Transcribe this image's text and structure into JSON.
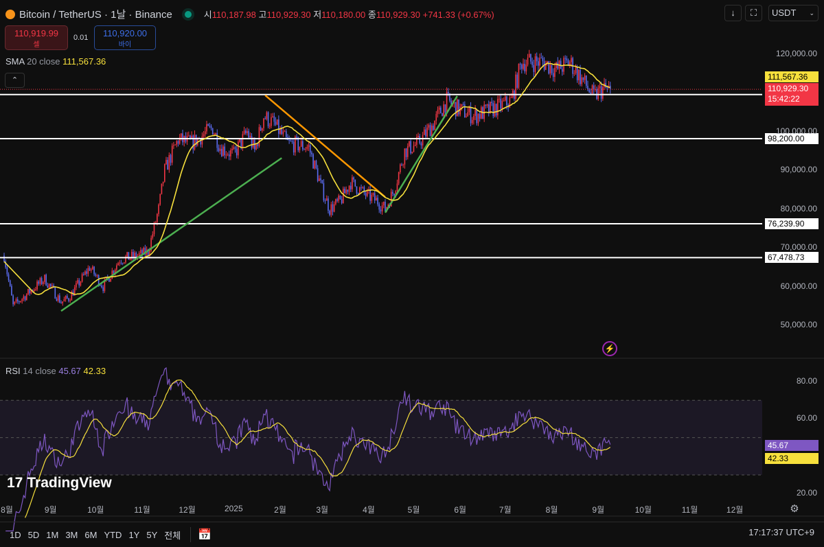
{
  "header": {
    "symbol": "Bitcoin / TetherUS · 1날 · Binance",
    "open_label": "시",
    "open": "110,187.98",
    "high_label": "고",
    "high": "110,929.30",
    "low_label": "저",
    "low": "110,180.00",
    "close_label": "종",
    "close": "110,929.30",
    "change": "+741.33 (+0.67%)"
  },
  "trade": {
    "sell_price": "110,919.99",
    "sell_label": "셀",
    "spread": "0.01",
    "buy_price": "110,920.00",
    "buy_label": "바이"
  },
  "toolbar": {
    "down_icon": "↓",
    "currency": "USDT"
  },
  "sma": {
    "label": "SMA",
    "params": "20 close",
    "value": "111,567.36"
  },
  "rsi": {
    "label": "RSI",
    "params": "14 close",
    "value": "45.67",
    "ma_value": "42.33"
  },
  "price_tags": {
    "sma": "111,567.36",
    "last": "110,929.30",
    "countdown": "15:42:22"
  },
  "bottom": {
    "ranges": [
      "1D",
      "5D",
      "1M",
      "3M",
      "6M",
      "YTD",
      "1Y",
      "5Y",
      "전체"
    ],
    "clock": "17:17:37 UTC+9"
  },
  "logo": "TradingView",
  "colors": {
    "up": "#f23645",
    "down": "#5b6cf0",
    "sma": "#f7e03c",
    "rsi": "#7e57c2",
    "green": "#4caf50",
    "orange": "#ff9800"
  },
  "chart_data": {
    "type": "candlestick",
    "title": "Bitcoin / TetherUS · 1D · Binance",
    "x_start": "2024-08-01",
    "x_unit": "day",
    "ylim": [
      43000,
      128000
    ],
    "y_ticks": [
      {
        "v": 120000,
        "t": "120,000.00"
      },
      {
        "v": 100000,
        "t": "100,000.00"
      },
      {
        "v": 90000,
        "t": "90,000.00"
      },
      {
        "v": 80000,
        "t": "80,000.00"
      },
      {
        "v": 70000,
        "t": "70,000.00"
      },
      {
        "v": 60000,
        "t": "60,000.00"
      },
      {
        "v": 50000,
        "t": "50,000.00"
      }
    ],
    "x_ticks": [
      {
        "d": 0,
        "t": "8월"
      },
      {
        "d": 31,
        "t": "9월"
      },
      {
        "d": 61,
        "t": "10월"
      },
      {
        "d": 92,
        "t": "11월"
      },
      {
        "d": 122,
        "t": "12월"
      },
      {
        "d": 153,
        "t": "2025"
      },
      {
        "d": 184,
        "t": "2월"
      },
      {
        "d": 212,
        "t": "3월"
      },
      {
        "d": 243,
        "t": "4월"
      },
      {
        "d": 273,
        "t": "5월"
      },
      {
        "d": 304,
        "t": "6월"
      },
      {
        "d": 334,
        "t": "7월"
      },
      {
        "d": 365,
        "t": "8월"
      },
      {
        "d": 396,
        "t": "9월"
      },
      {
        "d": 426,
        "t": "10월"
      },
      {
        "d": 457,
        "t": "11월"
      },
      {
        "d": 487,
        "t": "12월"
      }
    ],
    "close_keypoints": [
      [
        0,
        68000
      ],
      [
        6,
        55000
      ],
      [
        15,
        58000
      ],
      [
        27,
        62000
      ],
      [
        38,
        56000
      ],
      [
        43,
        57000
      ],
      [
        57,
        65000
      ],
      [
        66,
        60000
      ],
      [
        77,
        67000
      ],
      [
        89,
        68000
      ],
      [
        96,
        69000
      ],
      [
        103,
        80000
      ],
      [
        107,
        90000
      ],
      [
        116,
        98000
      ],
      [
        125,
        97000
      ],
      [
        139,
        101000
      ],
      [
        144,
        96000
      ],
      [
        153,
        94000
      ],
      [
        162,
        100000
      ],
      [
        167,
        95000
      ],
      [
        173,
        104000
      ],
      [
        180,
        102000
      ],
      [
        189,
        97000
      ],
      [
        203,
        96000
      ],
      [
        212,
        85000
      ],
      [
        217,
        80000
      ],
      [
        224,
        82000
      ],
      [
        231,
        87000
      ],
      [
        240,
        84000
      ],
      [
        249,
        82000
      ],
      [
        254,
        80000
      ],
      [
        260,
        85000
      ],
      [
        267,
        95000
      ],
      [
        276,
        97000
      ],
      [
        286,
        102000
      ],
      [
        295,
        108000
      ],
      [
        302,
        106000
      ],
      [
        313,
        104000
      ],
      [
        327,
        106000
      ],
      [
        338,
        108000
      ],
      [
        345,
        118000
      ],
      [
        359,
        118000
      ],
      [
        368,
        116000
      ],
      [
        377,
        118000
      ],
      [
        386,
        113000
      ],
      [
        393,
        109000
      ],
      [
        399,
        111000
      ],
      [
        404,
        110929.3
      ]
    ],
    "levels": [
      {
        "v": 109588,
        "t": "109,588.00"
      },
      {
        "v": 98200,
        "t": "98,200.00"
      },
      {
        "v": 76239.9,
        "t": "76,239.90"
      },
      {
        "v": 67478.73,
        "t": "67,478.73"
      }
    ],
    "trendlines": [
      {
        "color": "green",
        "from": [
          38,
          53700
        ],
        "to": [
          185,
          93200
        ]
      },
      {
        "color": "orange",
        "from": [
          174,
          109400
        ],
        "to": [
          254,
          83100
        ]
      },
      {
        "color": "green",
        "from": [
          254,
          79100
        ],
        "to": [
          302,
          109200
        ]
      }
    ],
    "sma_period": 20,
    "rsi_period": 14,
    "rsi_ticks": [
      {
        "v": 80,
        "t": "80.00"
      },
      {
        "v": 60,
        "t": "60.00"
      },
      {
        "v": 20,
        "t": "20.00"
      }
    ],
    "rsi_bands": [
      70,
      50,
      30
    ]
  }
}
